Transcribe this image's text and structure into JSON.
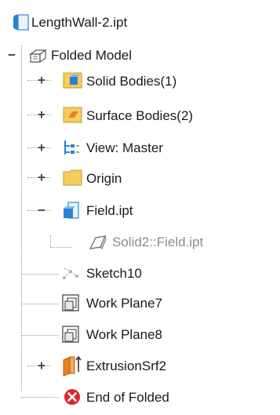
{
  "browser": {
    "root": {
      "label": "LengthWall-2.ipt",
      "icon": "part-file-icon"
    },
    "items": [
      {
        "label": "Folded Model",
        "icon": "folded-model-icon",
        "expander": "−"
      },
      {
        "label": "Solid Bodies(1)",
        "icon": "solid-bodies-folder-icon",
        "expander": "+"
      },
      {
        "label": "Surface Bodies(2)",
        "icon": "surface-bodies-folder-icon",
        "expander": "+"
      },
      {
        "label": "View: Master",
        "icon": "view-rep-icon",
        "expander": "+"
      },
      {
        "label": "Origin",
        "icon": "origin-folder-icon",
        "expander": "+"
      },
      {
        "label": "Field.ipt",
        "icon": "derived-part-icon",
        "expander": "−"
      },
      {
        "label": "Solid2::Field.ipt",
        "icon": "solid-body-icon"
      },
      {
        "label": "Sketch10",
        "icon": "sketch-icon"
      },
      {
        "label": "Work Plane7",
        "icon": "work-plane-icon"
      },
      {
        "label": "Work Plane8",
        "icon": "work-plane-icon"
      },
      {
        "label": "ExtrusionSrf2",
        "icon": "extrusion-surface-icon",
        "expander": "+"
      },
      {
        "label": "End of Folded",
        "icon": "end-of-part-icon"
      }
    ]
  },
  "colors": {
    "folder": "#f5cd5a",
    "folder_border": "#c99a22",
    "blue": "#2b7fd6",
    "orange": "#e8822a",
    "red": "#d9282f",
    "connector": "#9a9a9a"
  }
}
